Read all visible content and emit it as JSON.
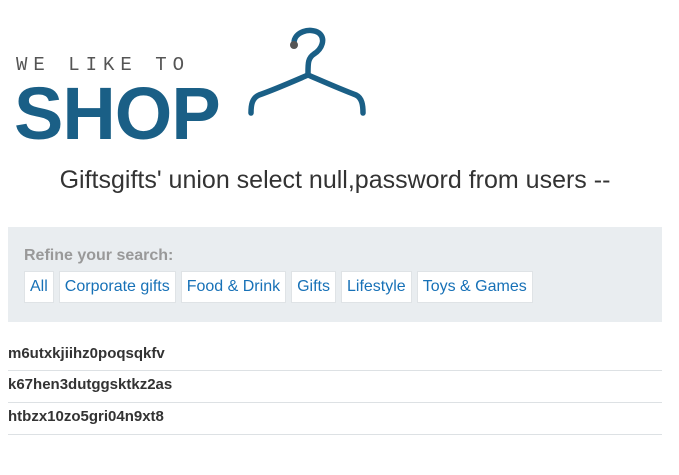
{
  "header": {
    "tagline": "WE LIKE TO",
    "logo_word": "SHOP"
  },
  "page_title": "Giftsgifts' union select null,password from users --",
  "refine": {
    "label": "Refine your search:",
    "categories": [
      "All",
      "Corporate gifts",
      "Food & Drink",
      "Gifts",
      "Lifestyle",
      "Toys & Games"
    ]
  },
  "results": [
    "m6utxkjiihz0poqsqkfv",
    "k67hen3dutggsktkz2as",
    "htbzx10zo5gri04n9xt8"
  ],
  "colors": {
    "brand": "#1a5f86",
    "link": "#1771b7",
    "filter_bg": "#e9edf0"
  },
  "icons": {
    "hanger": "clothes-hanger-icon"
  }
}
